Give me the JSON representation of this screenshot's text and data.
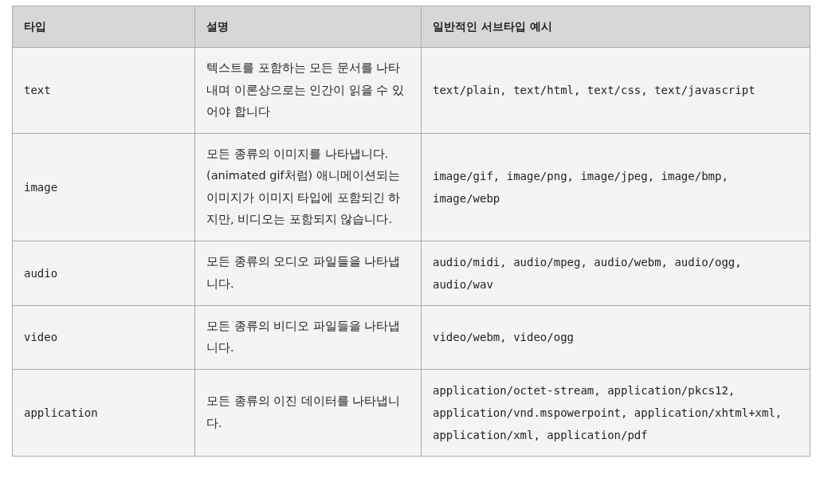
{
  "table": {
    "columns": [
      "타입",
      "설명",
      "일반적인 서브타입 예시"
    ],
    "rows": [
      {
        "type": "text",
        "description": "텍스트를 포함하는 모든 문서를 나타내며 이론상으로는 인간이 읽을 수 있어야 합니다",
        "examples": "text/plain, text/html, text/css, text/javascript"
      },
      {
        "type": "image",
        "description": "모든 종류의 이미지를 나타냅니다. (animated gif처럼) 애니메이션되는 이미지가 이미지 타입에 포함되긴 하지만, 비디오는 포함되지 않습니다.",
        "examples": "image/gif, image/png, image/jpeg, image/bmp, image/webp"
      },
      {
        "type": "audio",
        "description": "모든 종류의 오디오 파일들을 나타냅니다.",
        "examples": "audio/midi, audio/mpeg, audio/webm, audio/ogg, audio/wav"
      },
      {
        "type": "video",
        "description": "모든 종류의 비디오 파일들을 나타냅니다.",
        "examples": "video/webm, video/ogg"
      },
      {
        "type": "application",
        "description": "모든 종류의 이진 데이터를 나타냅니다.",
        "examples": "application/octet-stream, application/pkcs12, application/vnd.mspowerpoint, application/xhtml+xml, application/xml, application/pdf"
      }
    ]
  }
}
